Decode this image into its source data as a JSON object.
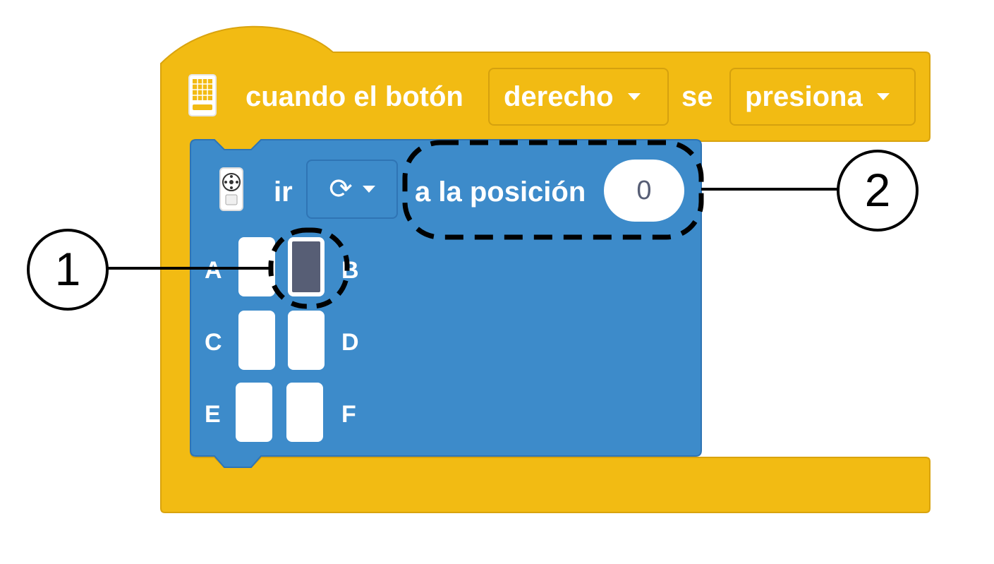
{
  "hat_block": {
    "label": "cuando el botón",
    "button_dropdown": "derecho",
    "connector": "se",
    "action_dropdown": "presiona",
    "icon": "hub-icon",
    "color": "#f2bb13"
  },
  "motor_block": {
    "icon": "motor-icon",
    "label_go": "ir",
    "direction_dropdown": "⟳",
    "label_position": "a la posición",
    "position_value": "0",
    "color": "#3d8bca"
  },
  "ports": [
    {
      "id": "A",
      "selected": false
    },
    {
      "id": "B",
      "selected": true
    },
    {
      "id": "C",
      "selected": false
    },
    {
      "id": "D",
      "selected": false
    },
    {
      "id": "E",
      "selected": false
    },
    {
      "id": "F",
      "selected": false
    }
  ],
  "callouts": [
    {
      "number": "1"
    },
    {
      "number": "2"
    }
  ]
}
